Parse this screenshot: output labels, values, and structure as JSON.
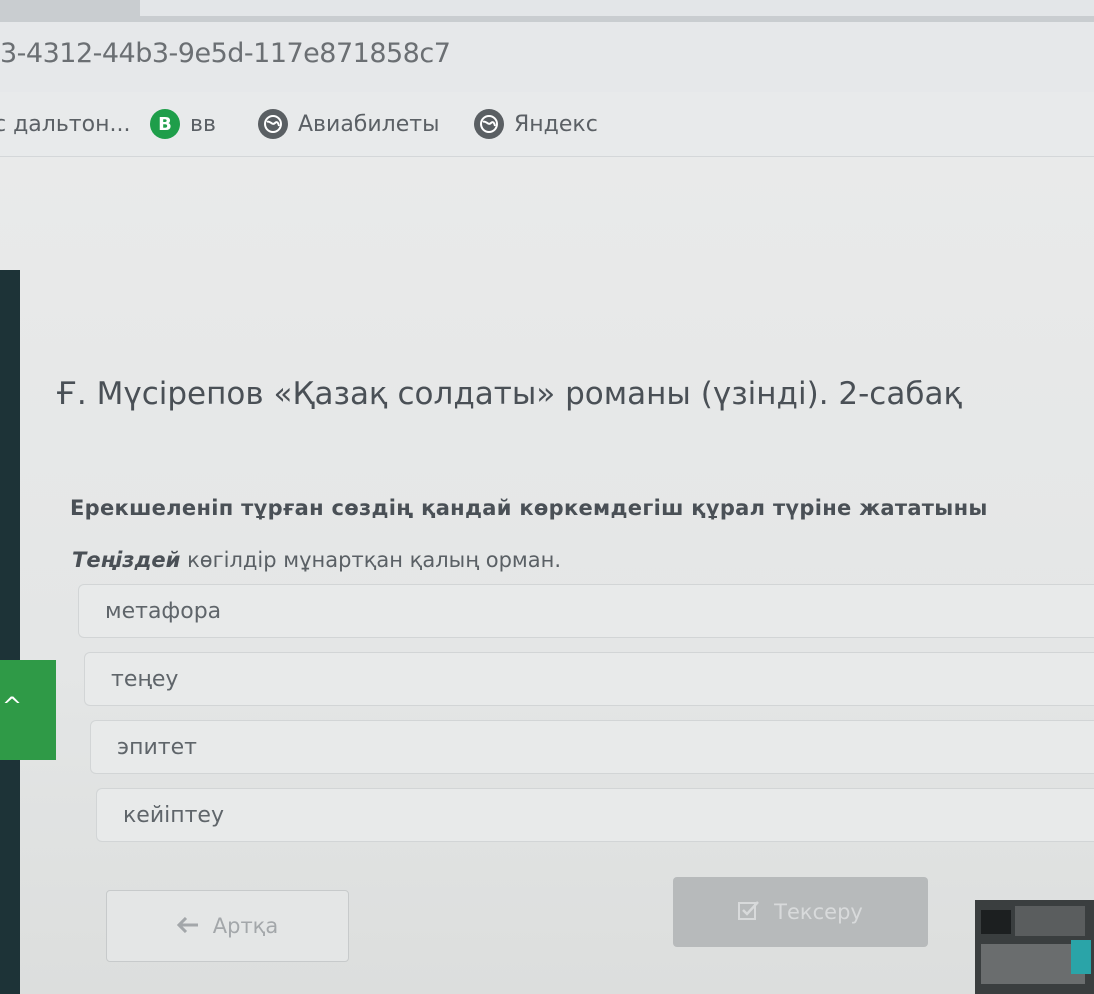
{
  "browser": {
    "url": "3-4312-44b3-9e5d-117e871858c7",
    "bookmarks": [
      {
        "label": "с дальтон...",
        "icon": "none"
      },
      {
        "label": "вв",
        "icon": "green-b-icon",
        "glyph": "B"
      },
      {
        "label": "Авиабилеты",
        "icon": "globe-icon"
      },
      {
        "label": "Яндекс",
        "icon": "globe-icon"
      }
    ]
  },
  "lesson": {
    "title": "Ғ. Мүсірепов «Қазақ солдаты» романы (үзінді). 2-сабақ"
  },
  "question": {
    "prompt": "Ерекшеленіп тұрған сөздің қандай көркемдегіш құрал түріне жататыны",
    "sentence_bold": "Теңіздей",
    "sentence_rest": " көгілдір мұнартқан қалың орман."
  },
  "options": [
    {
      "label": "метафора"
    },
    {
      "label": "теңеу"
    },
    {
      "label": "эпитет"
    },
    {
      "label": "кейіптеу"
    }
  ],
  "buttons": {
    "back_label": "Артқа",
    "check_label": "Тексеру"
  },
  "sidebar": {
    "toggle_glyph": "^"
  },
  "colors": {
    "sidebar_dark": "#1d3337",
    "sidebar_green": "#2f9a47",
    "check_button": "#b7babb"
  }
}
